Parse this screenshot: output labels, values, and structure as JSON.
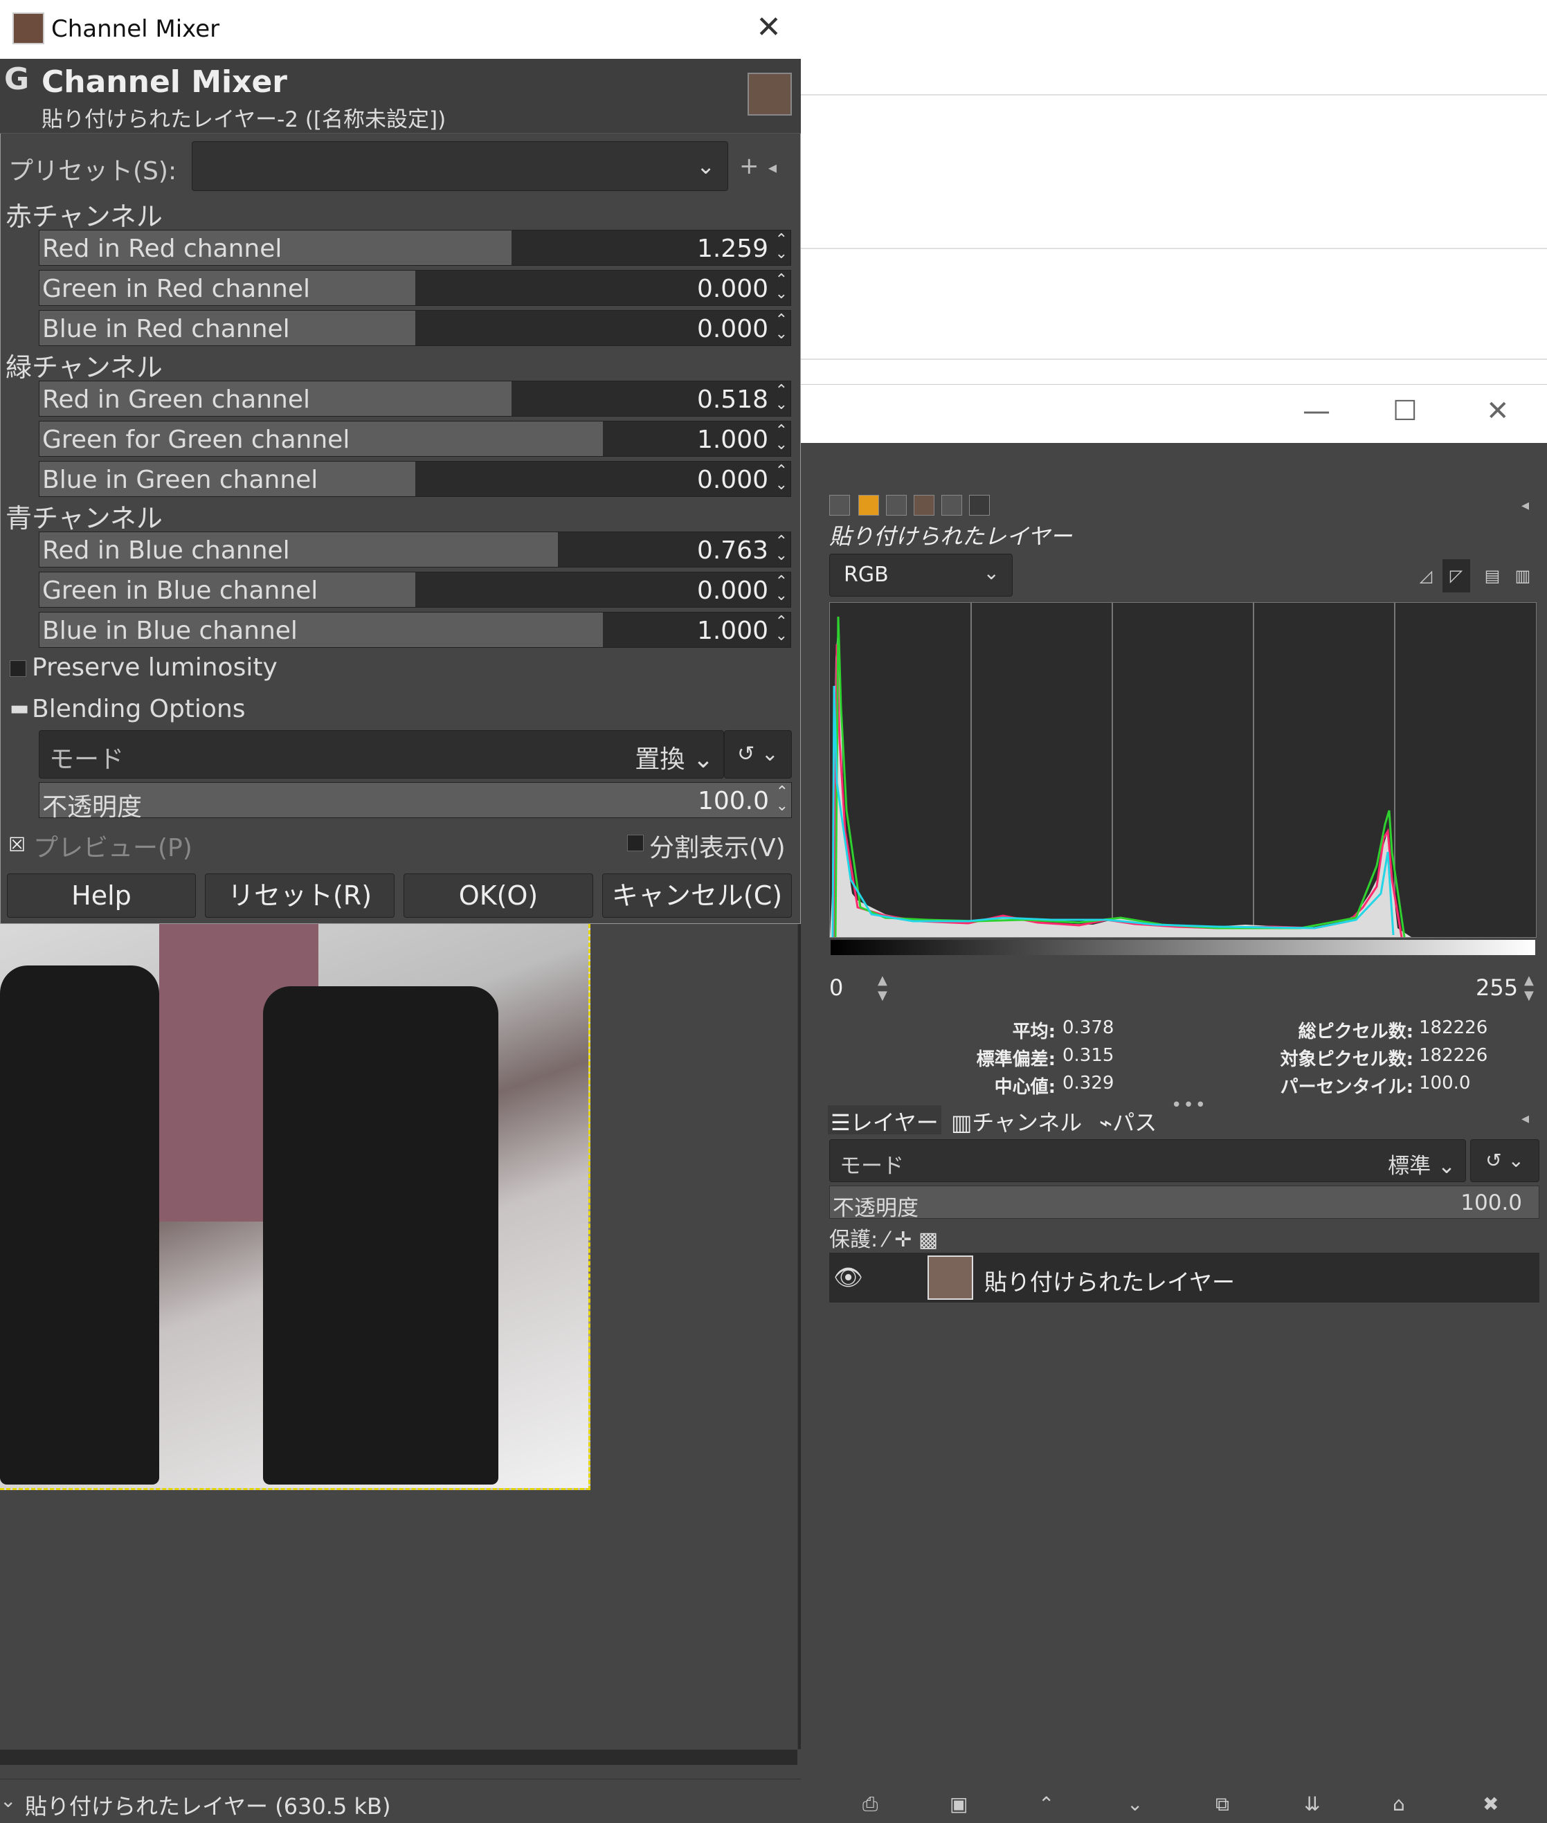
{
  "dialog": {
    "window_title": "Channel Mixer",
    "header_title": "Channel Mixer",
    "header_subtitle": "貼り付けられたレイヤー-2 ([名称未設定])",
    "preset_label": "プリセット(S):",
    "preset_value": "",
    "sections": {
      "red": "赤チャンネル",
      "green": "緑チャンネル",
      "blue": "青チャンネル"
    },
    "sliders": [
      {
        "label": "Red in Red channel",
        "value": "1.259",
        "fraction": 0.629
      },
      {
        "label": "Green in Red channel",
        "value": "0.000",
        "fraction": 0.5
      },
      {
        "label": "Blue in Red channel",
        "value": "0.000",
        "fraction": 0.5
      },
      {
        "label": "Red in Green channel",
        "value": "0.518",
        "fraction": 0.629
      },
      {
        "label": "Green for Green channel",
        "value": "1.000",
        "fraction": 0.75
      },
      {
        "label": "Blue in Green channel",
        "value": "0.000",
        "fraction": 0.5
      },
      {
        "label": "Red in Blue channel",
        "value": "0.763",
        "fraction": 0.69
      },
      {
        "label": "Green in Blue channel",
        "value": "0.000",
        "fraction": 0.5
      },
      {
        "label": "Blue in Blue channel",
        "value": "1.000",
        "fraction": 0.75
      }
    ],
    "preserve_luminosity": "Preserve luminosity",
    "blending_options": "Blending Options",
    "mode_label": "モード",
    "mode_value": "置換",
    "opacity_label": "不透明度",
    "opacity_value": "100.0",
    "preview_label": "プレビュー(P)",
    "split_label": "分割表示(V)",
    "buttons": {
      "help": "Help",
      "reset": "リセット(R)",
      "ok": "OK(O)",
      "cancel": "キャンセル(C)"
    }
  },
  "image_window": {
    "status": "貼り付けられたレイヤー (630.5 kB)"
  },
  "dock": {
    "histogram": {
      "layer_name": "貼り付けられたレイヤー",
      "channel": "RGB",
      "range_min": "0",
      "range_max": "255",
      "stats": {
        "mean_label": "平均:",
        "mean": "0.378",
        "stddev_label": "標準偏差:",
        "stddev": "0.315",
        "median_label": "中心値:",
        "median": "0.329",
        "pixels_label": "総ピクセル数:",
        "pixels": "182226",
        "count_label": "対象ピクセル数:",
        "count": "182226",
        "percentile_label": "パーセンタイル:",
        "percentile": "100.0"
      }
    },
    "tabs": {
      "layers": "レイヤー",
      "channels": "チャンネル",
      "paths": "パス"
    },
    "layers": {
      "mode_label": "モード",
      "mode_value": "標準",
      "opacity_label": "不透明度",
      "opacity_value": "100.0",
      "lock_label": "保護:",
      "layer_name": "貼り付けられたレイヤー"
    }
  },
  "colors": {
    "panel_bg": "#454545",
    "field_bg": "#2b2b2b",
    "slider_fill": "#5d5d5d",
    "selection": "#e5d400"
  }
}
